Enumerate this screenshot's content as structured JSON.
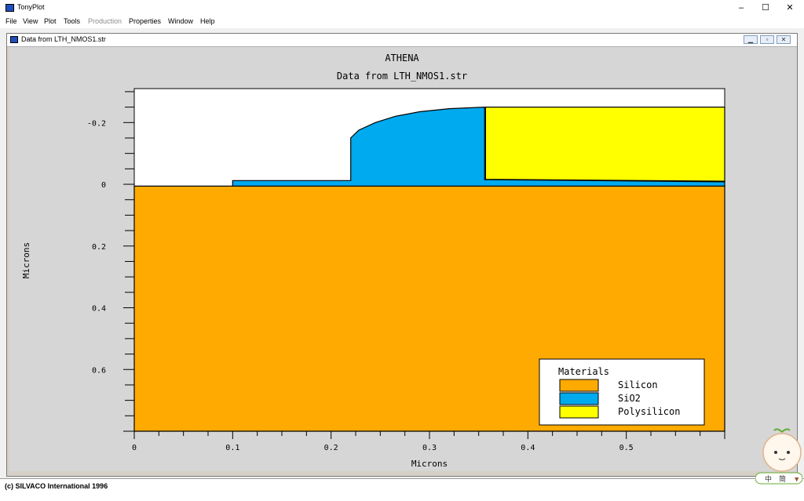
{
  "app": {
    "title": "TonyPlot",
    "window_controls": [
      "–",
      "☐",
      "✕"
    ]
  },
  "menu": [
    {
      "label": "File",
      "enabled": true
    },
    {
      "label": "View",
      "enabled": true
    },
    {
      "label": "Plot",
      "enabled": true
    },
    {
      "label": "Tools",
      "enabled": true
    },
    {
      "label": "Production",
      "enabled": false
    },
    {
      "label": "Properties",
      "enabled": true
    },
    {
      "label": "Window",
      "enabled": true
    },
    {
      "label": "Help",
      "enabled": true
    }
  ],
  "document": {
    "title": "Data from LTH_NMOS1.str"
  },
  "plot": {
    "title": "ATHENA",
    "subtitle": "Data from LTH_NMOS1.str",
    "xlabel": "Microns",
    "ylabel": "Microns",
    "x_ticks": [
      "0",
      "0.1",
      "0.2",
      "0.3",
      "0.4",
      "0.5"
    ],
    "y_ticks": [
      "-0.2",
      "0",
      "0.2",
      "0.4",
      "0.6"
    ],
    "legend": {
      "title": "Materials",
      "items": [
        {
          "label": "Silicon",
          "color": "#ffaa00"
        },
        {
          "label": "SiO2",
          "color": "#00aaee"
        },
        {
          "label": "Polysilicon",
          "color": "#ffff00"
        }
      ]
    }
  },
  "status": {
    "text": "(c) SILVACO International 1996"
  },
  "ime": {
    "chars": [
      "中",
      "简"
    ]
  },
  "chart_data": {
    "type": "area",
    "title": "ATHENA",
    "subtitle": "Data from LTH_NMOS1.str",
    "xlabel": "Microns",
    "ylabel": "Microns",
    "xlim": [
      0,
      0.6
    ],
    "ylim": [
      0.8,
      -0.31
    ],
    "grid": false,
    "legend_position": "bottom-right",
    "series": [
      {
        "name": "Silicon",
        "color": "#ffaa00",
        "polygon": [
          [
            0,
            0.006
          ],
          [
            0.6,
            0.006
          ],
          [
            0.6,
            0.8
          ],
          [
            0,
            0.8
          ]
        ]
      },
      {
        "name": "SiO2",
        "color": "#00aaee",
        "polygon": [
          [
            0.1,
            0.006
          ],
          [
            0.1,
            -0.012
          ],
          [
            0.22,
            -0.012
          ],
          [
            0.22,
            -0.15
          ],
          [
            0.228,
            -0.175
          ],
          [
            0.245,
            -0.2
          ],
          [
            0.265,
            -0.22
          ],
          [
            0.29,
            -0.235
          ],
          [
            0.32,
            -0.245
          ],
          [
            0.356,
            -0.25
          ],
          [
            0.356,
            -0.015
          ],
          [
            0.6,
            -0.008
          ],
          [
            0.6,
            0.006
          ]
        ]
      },
      {
        "name": "Polysilicon",
        "color": "#ffff00",
        "polygon": [
          [
            0.357,
            -0.016
          ],
          [
            0.357,
            -0.25
          ],
          [
            0.6,
            -0.25
          ],
          [
            0.6,
            -0.01
          ]
        ]
      }
    ]
  }
}
